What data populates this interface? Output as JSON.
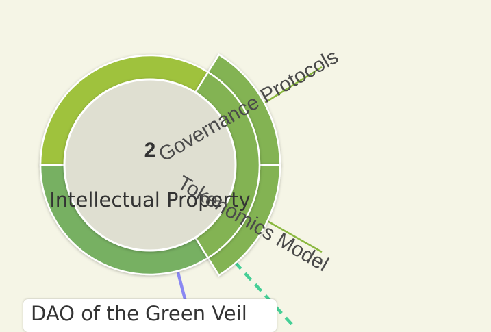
{
  "graph": {
    "center_count": "2",
    "center_label": "Intellectual Property",
    "outer_labels": [
      "Governance Protocols",
      "Tokenomics Model"
    ],
    "node_label": "DAO of the Green Veil"
  },
  "colors": {
    "background": "#f5f5e6",
    "core_fill": "#dfdfd1",
    "ring_top_left": "#9fc23d",
    "ring_lower": "#77b062",
    "ring_right": "#83b353",
    "edge_purple": "#8a88f2",
    "edge_teal_dashed": "#45cf96",
    "label_text": "#4a4a4a"
  }
}
